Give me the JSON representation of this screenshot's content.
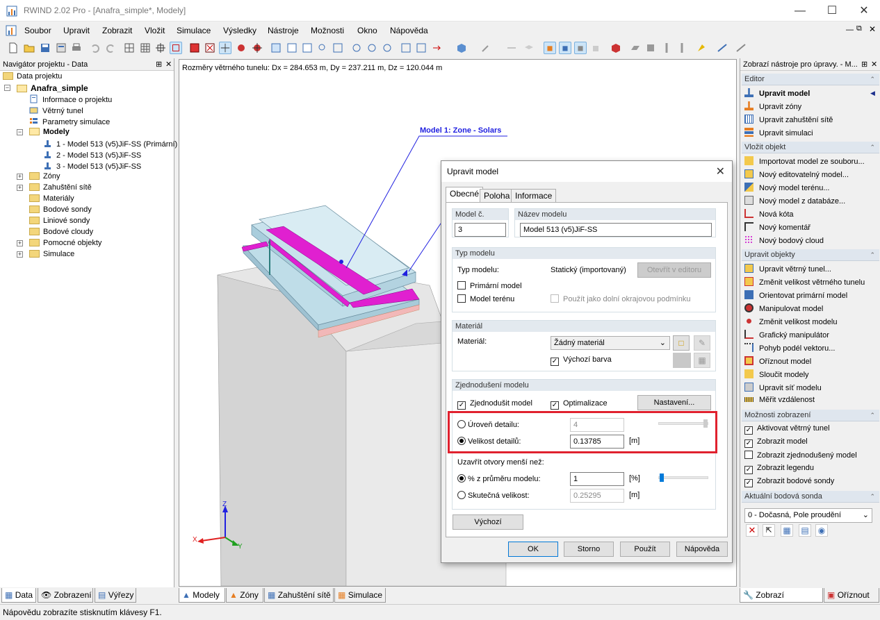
{
  "window": {
    "title": "RWIND 2.02 Pro - [Anafra_simple*, Modely]"
  },
  "menu": [
    "Soubor",
    "Upravit",
    "Zobrazit",
    "Vložit",
    "Simulace",
    "Výsledky",
    "Nástroje",
    "Možnosti",
    "Okno",
    "Nápověda"
  ],
  "navigator": {
    "title": "Navigátor projektu - Data",
    "root": "Data projektu",
    "project": "Anafra_simple",
    "items": [
      "Informace o projektu",
      "Větrný tunel",
      "Parametry simulace"
    ],
    "models_label": "Modely",
    "models": [
      "1 - Model 513 (v5)JiF-SS (Primární)",
      "2 - Model 513 (v5)JiF-SS",
      "3 - Model 513 (v5)JiF-SS"
    ],
    "folders": [
      "Zóny",
      "Zahuštění sítě",
      "Materiály",
      "Bodové sondy",
      "Liniové sondy",
      "Bodové cloudy",
      "Pomocné objekty",
      "Simulace"
    ],
    "tabs": [
      "Data",
      "Zobrazení",
      "Výřezy"
    ]
  },
  "viewport": {
    "info": "Rozměry větrného tunelu: Dx = 284.653 m, Dy = 237.211 m, Dz = 120.044 m",
    "annotation": "Model 1: Zone - Solars",
    "axes": {
      "z": "Z",
      "x": "X",
      "y": "Y"
    },
    "tabs": [
      "Modely",
      "Zóny",
      "Zahuštění sítě",
      "Simulace"
    ]
  },
  "right_pane": {
    "title": "Zobrazí nástroje pro úpravy. - M...",
    "editor": {
      "header": "Editor",
      "items": [
        "Upravit model",
        "Upravit zóny",
        "Upravit zahuštění sítě",
        "Upravit simulaci"
      ]
    },
    "insert": {
      "header": "Vložit objekt",
      "items": [
        "Importovat model ze souboru...",
        "Nový editovatelný model...",
        "Nový model terénu...",
        "Nový model z databáze...",
        "Nová kóta",
        "Nový komentář",
        "Nový bodový cloud"
      ]
    },
    "modify": {
      "header": "Upravit objekty",
      "items": [
        "Upravit větrný tunel...",
        "Změnit velikost větrného tunelu",
        "Orientovat primární model",
        "Manipulovat model",
        "Změnit velikost modelu",
        "Grafický manipulátor",
        "Pohyb podél vektoru...",
        "Oříznout model",
        "Sloučit modely",
        "Upravit síť modelu",
        "Měřit vzdálenost"
      ]
    },
    "display": {
      "header": "Možnosti zobrazení",
      "items": [
        "Aktivovat větrný tunel",
        "Zobrazit model",
        "Zobrazit zjednodušený model",
        "Zobrazit legendu",
        "Zobrazit bodové sondy"
      ],
      "checked": [
        true,
        true,
        false,
        true,
        true
      ]
    },
    "probe": {
      "header": "Aktuální bodová sonda",
      "value": "0 - Dočasná, Pole proudění"
    },
    "tabs": [
      "Zobrazí nástroje...",
      "Oříznout"
    ]
  },
  "dialog": {
    "title": "Upravit model",
    "tabs": [
      "Obecné",
      "Poloha",
      "Informace"
    ],
    "model_no_label": "Model č.",
    "model_no": "3",
    "model_name_label": "Název modelu",
    "model_name": "Model 513 (v5)JiF-SS",
    "type_group": "Typ modelu",
    "type_label": "Typ modelu:",
    "type_value": "Statický (importovaný)",
    "open_editor": "Otevřít v editoru",
    "primary": "Primární model",
    "terrain": "Model terénu",
    "use_bc": "Použít jako dolní okrajovou podmínku",
    "material_group": "Materiál",
    "material_label": "Materiál:",
    "material_value": "Žádný materiál",
    "default_color": "Výchozí barva",
    "simplify_group": "Zjednodušení modelu",
    "simplify": "Zjednodušit model",
    "optimize": "Optimalizace",
    "settings": "Nastavení...",
    "level_label": "Úroveň detailu:",
    "level_value": "4",
    "size_label": "Velikost detailů:",
    "size_value": "0.13785",
    "unit_m": "[m]",
    "close_label": "Uzavřít otvory menší než:",
    "pct_label": "% z průměru modelu:",
    "pct_value": "1",
    "unit_pct": "[%]",
    "real_label": "Skutečná velikost:",
    "real_value": "0.25295",
    "default_btn": "Výchozí",
    "ok": "OK",
    "cancel": "Storno",
    "apply": "Použít",
    "help": "Nápověda"
  },
  "status": "Nápovědu zobrazíte stisknutím klávesy F1.",
  "colors": {
    "accent": "#0078d7",
    "highlight": "#e0212e",
    "magenta": "#e020d0"
  }
}
